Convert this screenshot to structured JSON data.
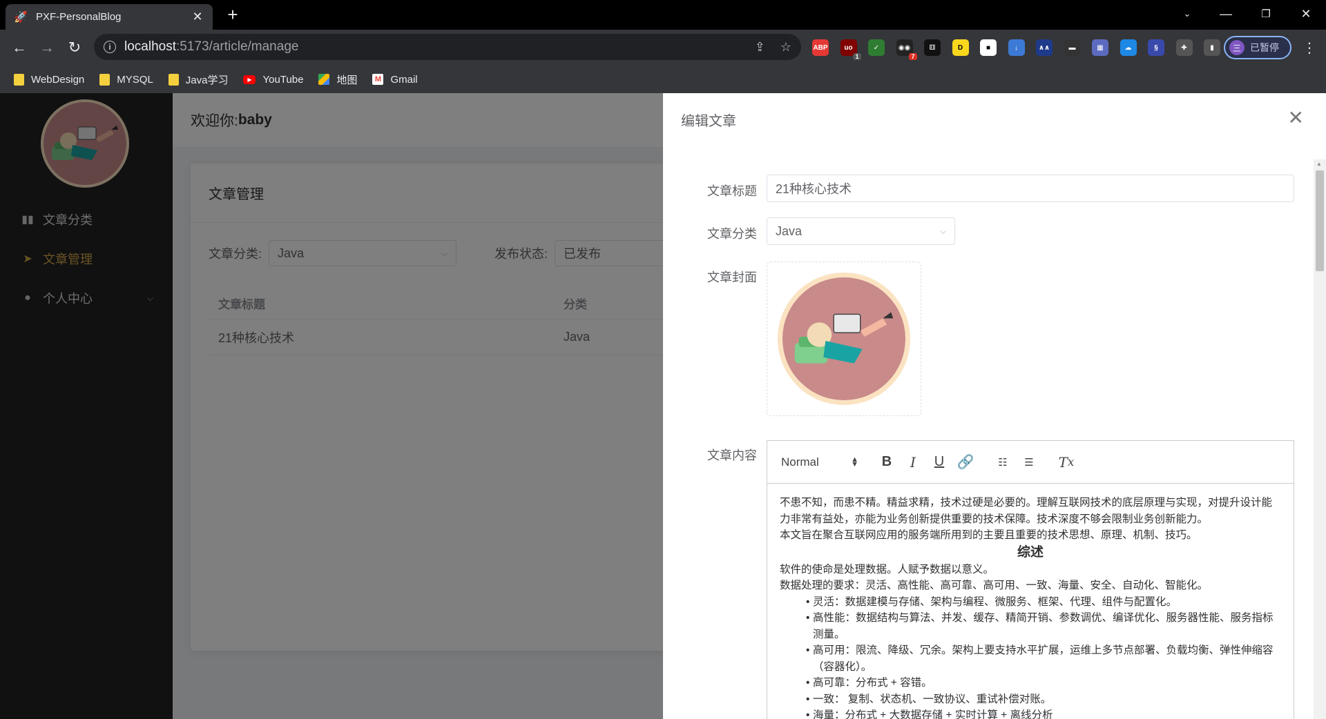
{
  "browser": {
    "tab_title": "PXF-PersonalBlog",
    "new_tab": "+",
    "url_host": "localhost",
    "url_path": ":5173/article/manage",
    "profile_initial": "三",
    "profile_status": "已暂停",
    "extensions": [
      {
        "name": "adblock-plus-extension-icon",
        "text": "ABP",
        "color": "#e53935"
      },
      {
        "name": "ublock-extension-icon",
        "text": "uo",
        "color": "#800000",
        "badge": "1"
      },
      {
        "name": "shield-extension-icon",
        "text": "✓",
        "color": "#2e7d32"
      },
      {
        "name": "tampermonkey-extension-icon",
        "text": "◉◉",
        "color": "#222",
        "badge": "7"
      },
      {
        "name": "dice-extension-icon",
        "text": "⚅",
        "color": "#111"
      },
      {
        "name": "yellow-extension-icon",
        "text": "D",
        "color": "#f9d71c"
      },
      {
        "name": "square-extension-icon",
        "text": "■",
        "color": "#fff"
      },
      {
        "name": "download-extension-icon",
        "text": "↓",
        "color": "#3d7ad6"
      },
      {
        "name": "mountain-extension-icon",
        "text": "∧∧",
        "color": "#1e3a8a"
      },
      {
        "name": "terminal-extension-icon",
        "text": "▬",
        "color": "#333"
      },
      {
        "name": "grid-extension-icon",
        "text": "▦",
        "color": "#5c6bc0"
      },
      {
        "name": "cloud-extension-icon",
        "text": "☁",
        "color": "#1e88e5"
      },
      {
        "name": "swirl-extension-icon",
        "text": "§",
        "color": "#3949ab"
      },
      {
        "name": "puzzle-extension-icon",
        "text": "✚",
        "color": "#555"
      },
      {
        "name": "sidepanel-extension-icon",
        "text": "▮",
        "color": "#555"
      }
    ]
  },
  "bookmarks": [
    {
      "name": "bookmark-webdesign",
      "label": "WebDesign",
      "kind": "folder"
    },
    {
      "name": "bookmark-mysql",
      "label": "MYSQL",
      "kind": "folder"
    },
    {
      "name": "bookmark-java",
      "label": "Java学习",
      "kind": "folder"
    },
    {
      "name": "bookmark-youtube",
      "label": "YouTube",
      "kind": "yt"
    },
    {
      "name": "bookmark-maps",
      "label": "地图",
      "kind": "maps"
    },
    {
      "name": "bookmark-gmail",
      "label": "Gmail",
      "kind": "gmail"
    }
  ],
  "sidebar": {
    "items": [
      {
        "label": "文章分类",
        "icon": "book-icon"
      },
      {
        "label": "文章管理",
        "icon": "paper-plane-icon"
      },
      {
        "label": "个人中心",
        "icon": "user-icon"
      }
    ]
  },
  "header": {
    "welcome_prefix": "欢迎你:",
    "username": "baby"
  },
  "page": {
    "card_title": "文章管理",
    "filter_category_label": "文章分类:",
    "filter_category_value": "Java",
    "filter_state_label": "发布状态:",
    "filter_state_value": "已发布",
    "columns": [
      "文章标题",
      "分类"
    ],
    "rows": [
      {
        "title": "21种核心技术",
        "category": "Java"
      }
    ]
  },
  "drawer": {
    "title": "编辑文章",
    "label_title": "文章标题",
    "value_title": "21种核心技术",
    "label_category": "文章分类",
    "value_category": "Java",
    "label_cover": "文章封面",
    "label_content": "文章内容",
    "toolbar_format": "Normal",
    "content": {
      "p1": "不患不知，而患不精。精益求精，技术过硬是必要的。理解互联网技术的底层原理与实现，对提升设计能力非常有益处，亦能为业务创新提供重要的技术保障。技术深度不够会限制业务创新能力。",
      "p2": "本文旨在聚合互联网应用的服务端所用到的主要且重要的技术思想、原理、机制、技巧。",
      "heading": "综述",
      "p3": "软件的使命是处理数据。人赋予数据以意义。",
      "p4": "数据处理的要求：灵活、高性能、高可靠、高可用、一致、海量、安全、自动化、智能化。",
      "list": [
        "灵活：数据建模与存储、架构与编程、微服务、框架、代理、组件与配置化。",
        "高性能：数据结构与算法、并发、缓存、精简开销、参数调优、编译优化、服务器性能、服务指标测量。",
        "高可用：限流、降级、冗余。架构上要支持水平扩展，运维上多节点部署、负载均衡、弹性伸缩容（容器化）。",
        "高可靠：分布式 + 容错。",
        "一致：  复制、状态机、一致协议、重试补偿对账。",
        "海量：分布式 + 大数据存储 + 实时计算 + 离线分析"
      ]
    }
  }
}
